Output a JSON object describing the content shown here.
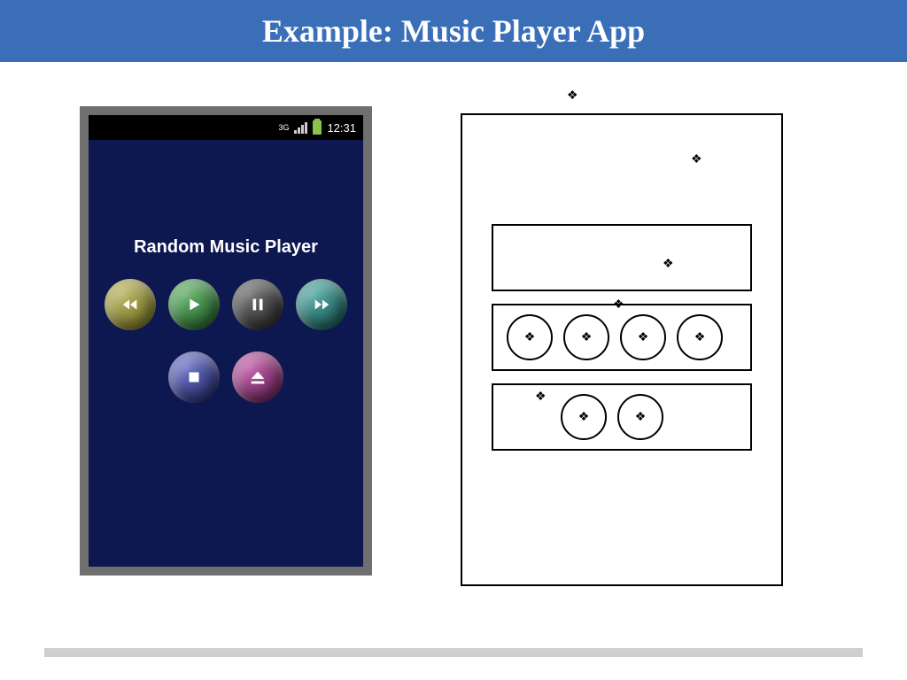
{
  "title": "Example: Music Player App",
  "status": {
    "net": "3G",
    "time": "12:31"
  },
  "app": {
    "title": "Random Music Player"
  },
  "buttons": {
    "rewind": "rewind",
    "play": "play",
    "pause": "pause",
    "forward": "forward",
    "stop": "stop",
    "eject": "eject"
  },
  "bullet": "❖"
}
